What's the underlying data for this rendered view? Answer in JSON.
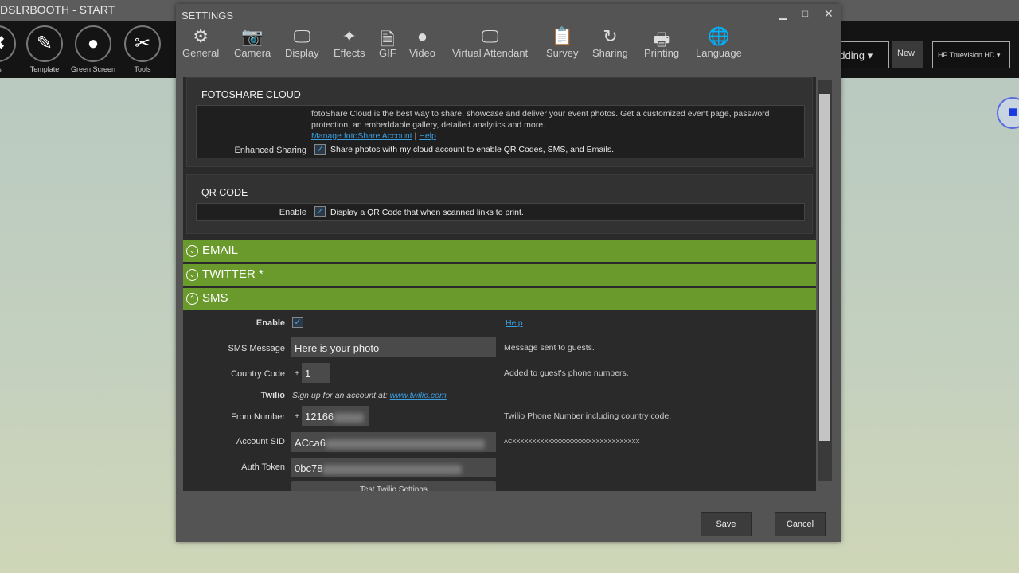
{
  "app": {
    "title": "DSLRBOOTH - START",
    "tools": [
      "gs",
      "Template",
      "Green Screen",
      "Tools"
    ],
    "event_select": "edding",
    "new_label": "New",
    "camera_select": "HP Truevision HD"
  },
  "settings": {
    "title": "SETTINGS",
    "tabs": [
      {
        "label": "General",
        "icon": "gear-icon"
      },
      {
        "label": "Camera",
        "icon": "camera-icon"
      },
      {
        "label": "Display",
        "icon": "monitor-icon"
      },
      {
        "label": "Effects",
        "icon": "effects-icon"
      },
      {
        "label": "GIF",
        "icon": "gif-icon"
      },
      {
        "label": "Video",
        "icon": "video-icon"
      },
      {
        "label": "Virtual Attendant",
        "icon": "virtual-attendant-icon"
      },
      {
        "label": "Survey",
        "icon": "clipboard-icon"
      },
      {
        "label": "Sharing",
        "icon": "sharing-icon"
      },
      {
        "label": "Printing",
        "icon": "printer-icon"
      },
      {
        "label": "Language",
        "icon": "globe-icon"
      }
    ],
    "fotoshare": {
      "title": "FOTOSHARE CLOUD",
      "desc1": "fotoShare Cloud is the best way to share, showcase and deliver your event photos. Get a customized event page, password",
      "desc2": "protection, an embeddable gallery, detailed analytics and more.",
      "manage_link": "Manage fotoShare Account",
      "sep": "|",
      "help_link": "Help",
      "enhanced_label": "Enhanced Sharing",
      "enhanced_checked": true,
      "enhanced_text": "Share photos with my cloud account to enable QR Codes, SMS, and Emails."
    },
    "qr": {
      "title": "QR CODE",
      "enable_label": "Enable",
      "checked": true,
      "text": "Display a QR Code that when scanned links to print."
    },
    "sections": {
      "email": "EMAIL",
      "twitter": "TWITTER *",
      "sms": "SMS"
    },
    "sms": {
      "enable_label": "Enable",
      "enabled": true,
      "help": "Help",
      "message_label": "SMS Message",
      "message": "Here is your photo",
      "message_hint": "Message sent to guests.",
      "country_label": "Country Code",
      "plus": "+",
      "country": "1",
      "country_hint": "Added to guest's phone numbers.",
      "twilio_label": "Twilio",
      "twilio_text": "Sign up for an account at:",
      "twilio_link": "www.twilio.com",
      "from_label": "From Number",
      "from": "12166",
      "from_hint": "Twilio Phone Number including country code.",
      "sid_label": "Account SID",
      "sid": "ACca6",
      "sid_hint": "ACXXXXXXXXXXXXXXXXXXXXXXXXXXXXXXXX",
      "token_label": "Auth Token",
      "token": "0bc78",
      "test_button": "Test Twilio Settings"
    },
    "save": "Save",
    "cancel": "Cancel"
  },
  "colors": {
    "section_bar": "#6a9a2c",
    "link": "#3a9ee0"
  }
}
